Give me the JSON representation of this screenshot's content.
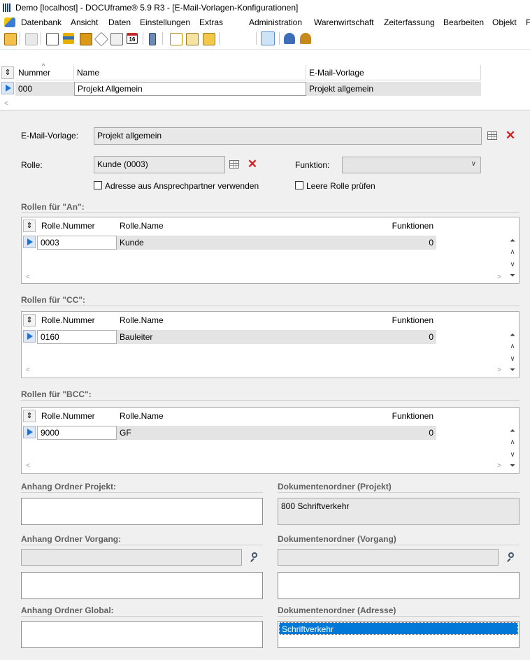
{
  "window": {
    "title": "Demo [localhost] - DOCUframe® 5.9 R3 - [E-Mail-Vorlagen-Konfigurationen]"
  },
  "menu": {
    "items": [
      "Datenbank",
      "Ansicht",
      "Daten",
      "Einstellungen",
      "Extras",
      "Administration",
      "Warenwirtschaft",
      "Zeiterfassung",
      "Bearbeiten",
      "Objekt",
      "F"
    ]
  },
  "toolbar": {
    "icons": [
      "user-icon",
      "print-icon",
      "card-icon",
      "list-icon",
      "book-icon",
      "tag-icon",
      "notes-icon",
      "calendar-icon",
      "phone-icon",
      "document-icon",
      "mail-icon",
      "folder-icon",
      "search-icon",
      "find-icon",
      "form-view-icon",
      "person-icon",
      "people-icon"
    ],
    "calendar_day": "16"
  },
  "top_grid": {
    "columns": [
      "Nummer",
      "Name",
      "E-Mail-Vorlage"
    ],
    "rows": [
      {
        "nummer": "000",
        "name": "Projekt Allgemein",
        "vorlage": "Projekt allgemein"
      }
    ]
  },
  "form": {
    "email_vorlage_label": "E-Mail-Vorlage:",
    "email_vorlage_value": "Projekt allgemein",
    "rolle_label": "Rolle:",
    "rolle_value": "Kunde (0003)",
    "funktion_label": "Funktion:",
    "funktion_value": "",
    "adresse_checkbox": "Adresse aus Ansprechpartner verwenden",
    "leere_rolle_checkbox": "Leere Rolle prüfen"
  },
  "rollen_an": {
    "title": "Rollen für \"An\":",
    "columns": [
      "Rolle.Nummer",
      "Rolle.Name",
      "Funktionen"
    ],
    "row": {
      "nummer": "0003",
      "name": "Kunde",
      "funktionen": "0"
    }
  },
  "rollen_cc": {
    "title": "Rollen für \"CC\":",
    "columns": [
      "Rolle.Nummer",
      "Rolle.Name",
      "Funktionen"
    ],
    "row": {
      "nummer": "0160",
      "name": "Bauleiter",
      "funktionen": "0"
    }
  },
  "rollen_bcc": {
    "title": "Rollen für \"BCC\":",
    "columns": [
      "Rolle.Nummer",
      "Rolle.Name",
      "Funktionen"
    ],
    "row": {
      "nummer": "9000",
      "name": "GF",
      "funktionen": "0"
    }
  },
  "anhang": {
    "projekt_title": "Anhang Ordner Projekt:",
    "vorgang_title": "Anhang Ordner Vorgang:",
    "global_title": "Anhang Ordner Global:"
  },
  "dokumente": {
    "projekt_title": "Dokumentenordner (Projekt)",
    "projekt_value": "800 Schriftverkehr",
    "vorgang_title": "Dokumentenordner (Vorgang)",
    "adresse_title": "Dokumentenordner (Adresse)",
    "adresse_value": "Schriftverkehr"
  },
  "colors": {
    "selection": "#0078d7",
    "delete": "#d42020",
    "row_indicator": "#1e73d2"
  }
}
